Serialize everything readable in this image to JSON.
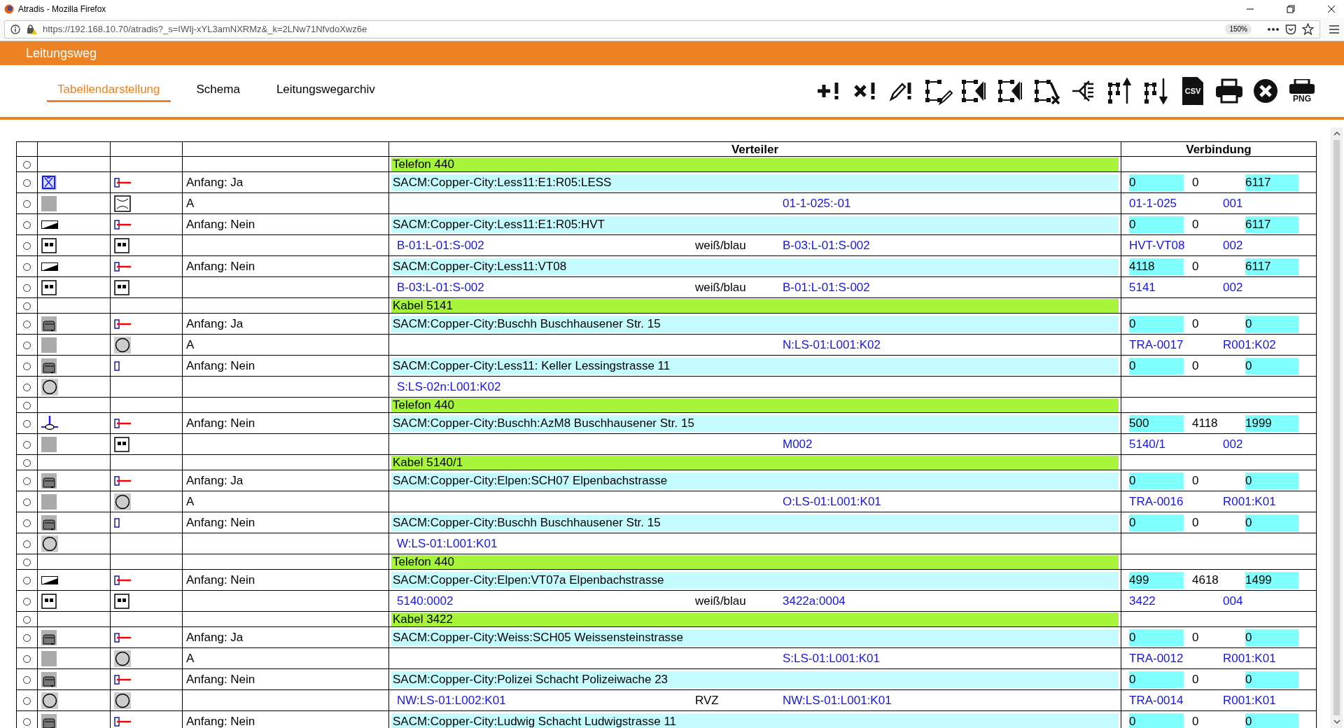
{
  "browser": {
    "title": "Atradis - Mozilla Firefox",
    "url": "https://192.168.10.70/atradis?_s=IWIj-xYL3amNXRMz&_k=2LNw71NfvdoXwz6e",
    "zoom": "150%"
  },
  "header": {
    "title": "Leitungsweg"
  },
  "tabs": [
    {
      "label": "Tabellendarstellung",
      "selected": true
    },
    {
      "label": "Schema",
      "selected": false
    },
    {
      "label": "Leitungswegarchiv",
      "selected": false
    }
  ],
  "toolbar": [
    {
      "kind": "add"
    },
    {
      "kind": "delete"
    },
    {
      "kind": "edit"
    },
    {
      "kind": "edit-route"
    },
    {
      "kind": "route-left"
    },
    {
      "kind": "route-split"
    },
    {
      "kind": "route-remove"
    },
    {
      "kind": "fan"
    },
    {
      "kind": "up"
    },
    {
      "kind": "down"
    },
    {
      "kind": "csv",
      "label": "CSV"
    },
    {
      "kind": "print"
    },
    {
      "kind": "close"
    },
    {
      "kind": "png",
      "label": "PNG"
    }
  ],
  "table": {
    "headers": {
      "verteiler": "Verteiler",
      "verbindung": "Verbindung"
    },
    "rows": [
      {
        "kind": "group",
        "selected": false,
        "label": "Telefon 440"
      },
      {
        "kind": "main",
        "selected": false,
        "icon_1": {
          "kind": "splice"
        },
        "icon_2": {
          "kind": "plug"
        },
        "text": "Anfang: Ja",
        "verteiler": "SACM:Copper-City:Less11:E1:R05:LESS",
        "verbindung": [
          "0",
          "0",
          "6117"
        ]
      },
      {
        "kind": "detail",
        "selected": false,
        "icon_1": {
          "kind": "blank"
        },
        "icon_2": {
          "kind": "cross-box"
        },
        "text": "A",
        "verteiler_right": "01-1-025:-01",
        "verbindung": [
          "01-1-025",
          "001"
        ]
      },
      {
        "kind": "main",
        "selected": false,
        "icon_1": {
          "kind": "ramp"
        },
        "icon_2": {
          "kind": "plug"
        },
        "text": "Anfang: Nein",
        "verteiler": "SACM:Copper-City:Less11:E1:R05:HVT",
        "verbindung": [
          "0",
          "0",
          "6117"
        ]
      },
      {
        "kind": "detail",
        "selected": false,
        "icon_1": {
          "kind": "socket"
        },
        "icon_2": {
          "kind": "socket"
        },
        "verteiler_left": "B-01:L-01:S-002",
        "verteiler_middle": "weiß/blau",
        "verteiler_right": "B-03:L-01:S-002",
        "verbindung": [
          "HVT-VT08",
          "002"
        ]
      },
      {
        "kind": "main",
        "selected": false,
        "icon_1": {
          "kind": "ramp"
        },
        "icon_2": {
          "kind": "plug"
        },
        "text": "Anfang: Nein",
        "verteiler": "SACM:Copper-City:Less11:VT08",
        "verbindung": [
          "4118",
          "0",
          "6117"
        ]
      },
      {
        "kind": "detail",
        "selected": false,
        "icon_1": {
          "kind": "socket"
        },
        "icon_2": {
          "kind": "socket"
        },
        "verteiler_left": "B-03:L-01:S-002",
        "verteiler_middle": "weiß/blau",
        "verteiler_right": "B-01:L-01:S-002",
        "verbindung": [
          "5141",
          "002"
        ]
      },
      {
        "kind": "group",
        "selected": false,
        "label": "Kabel 5141"
      },
      {
        "kind": "main",
        "selected": false,
        "icon_1": {
          "kind": "shaft"
        },
        "icon_2": {
          "kind": "plug"
        },
        "text": "Anfang: Ja",
        "verteiler": "SACM:Copper-City:Buschh Buschhausener Str. 15",
        "verbindung": [
          "0",
          "0",
          "0"
        ]
      },
      {
        "kind": "detail",
        "selected": false,
        "icon_1": {
          "kind": "blank"
        },
        "icon_2": {
          "kind": "circle"
        },
        "text": "A",
        "verteiler_right": "N:LS-01:L001:K02",
        "verbindung": [
          "TRA-0017",
          "R001:K02"
        ]
      },
      {
        "kind": "main",
        "selected": false,
        "icon_1": {
          "kind": "shaft"
        },
        "icon_2": {
          "kind": "marker"
        },
        "text": "Anfang: Nein",
        "verteiler": "SACM:Copper-City:Less11: Keller Lessingstrasse 11",
        "verbindung": [
          "0",
          "0",
          "0"
        ]
      },
      {
        "kind": "detail",
        "selected": false,
        "icon_1": {
          "kind": "circle"
        },
        "verteiler_left": "S:LS-02n:L001:K02"
      },
      {
        "kind": "group",
        "selected": false,
        "label": "Telefon 440"
      },
      {
        "kind": "main",
        "selected": false,
        "icon_1": {
          "kind": "pole"
        },
        "icon_2": {
          "kind": "plug"
        },
        "text": "Anfang: Nein",
        "verteiler": "SACM:Copper-City:Buschh:AzM8 Buschhausener Str. 15",
        "verbindung": [
          "500",
          "4118",
          "1999"
        ]
      },
      {
        "kind": "detail",
        "selected": false,
        "icon_1": {
          "kind": "blank"
        },
        "icon_2": {
          "kind": "socket"
        },
        "verteiler_right": "M002",
        "verbindung": [
          "5140/1",
          "002"
        ]
      },
      {
        "kind": "group",
        "selected": false,
        "label": "Kabel 5140/1"
      },
      {
        "kind": "main",
        "selected": false,
        "icon_1": {
          "kind": "shaft"
        },
        "icon_2": {
          "kind": "plug"
        },
        "text": "Anfang: Ja",
        "verteiler": "SACM:Copper-City:Elpen:SCH07 Elpenbachstrasse",
        "verbindung": [
          "0",
          "0",
          "0"
        ]
      },
      {
        "kind": "detail",
        "selected": false,
        "icon_1": {
          "kind": "blank"
        },
        "icon_2": {
          "kind": "circle"
        },
        "text": "A",
        "verteiler_right": "O:LS-01:L001:K01",
        "verbindung": [
          "TRA-0016",
          "R001:K01"
        ]
      },
      {
        "kind": "main",
        "selected": false,
        "icon_1": {
          "kind": "shaft"
        },
        "icon_2": {
          "kind": "marker"
        },
        "text": "Anfang: Nein",
        "verteiler": "SACM:Copper-City:Buschh Buschhausener Str. 15",
        "verbindung": [
          "0",
          "0",
          "0"
        ]
      },
      {
        "kind": "detail",
        "selected": false,
        "icon_1": {
          "kind": "circle"
        },
        "verteiler_left": "W:LS-01:L001:K01"
      },
      {
        "kind": "group",
        "selected": false,
        "label": "Telefon 440"
      },
      {
        "kind": "main",
        "selected": false,
        "icon_1": {
          "kind": "ramp"
        },
        "icon_2": {
          "kind": "plug"
        },
        "text": "Anfang: Nein",
        "verteiler": "SACM:Copper-City:Elpen:VT07a Elpenbachstrasse",
        "verbindung": [
          "499",
          "4618",
          "1499"
        ]
      },
      {
        "kind": "detail",
        "selected": false,
        "icon_1": {
          "kind": "socket"
        },
        "icon_2": {
          "kind": "socket"
        },
        "verteiler_left": "5140:0002",
        "verteiler_middle": "weiß/blau",
        "verteiler_right": "3422a:0004",
        "verbindung": [
          "3422",
          "004"
        ]
      },
      {
        "kind": "group",
        "selected": false,
        "label": "Kabel 3422"
      },
      {
        "kind": "main",
        "selected": false,
        "icon_1": {
          "kind": "shaft"
        },
        "icon_2": {
          "kind": "plug"
        },
        "text": "Anfang: Ja",
        "verteiler": "SACM:Copper-City:Weiss:SCH05 Weissensteinstrasse",
        "verbindung": [
          "0",
          "0",
          "0"
        ]
      },
      {
        "kind": "detail",
        "selected": false,
        "icon_1": {
          "kind": "blank"
        },
        "icon_2": {
          "kind": "circle"
        },
        "text": "A",
        "verteiler_right": "S:LS-01:L001:K01",
        "verbindung": [
          "TRA-0012",
          "R001:K01"
        ]
      },
      {
        "kind": "main",
        "selected": false,
        "icon_1": {
          "kind": "shaft"
        },
        "icon_2": {
          "kind": "plug"
        },
        "text": "Anfang: Nein",
        "verteiler": "SACM:Copper-City:Polizei Schacht Polizeiwache 23",
        "verbindung": [
          "0",
          "0",
          "0"
        ]
      },
      {
        "kind": "detail",
        "selected": false,
        "icon_1": {
          "kind": "circle"
        },
        "icon_2": {
          "kind": "circle"
        },
        "verteiler_left": "NW:LS-01:L002:K01",
        "verteiler_middle": "RVZ",
        "verteiler_right": "NW:LS-01:L001:K01",
        "verbindung": [
          "TRA-0014",
          "R001:K01"
        ]
      },
      {
        "kind": "main",
        "selected": false,
        "icon_1": {
          "kind": "shaft"
        },
        "icon_2": {
          "kind": "plug"
        },
        "text": "Anfang: Nein",
        "verteiler": "SACM:Copper-City:Ludwig Schacht Ludwigstrasse 11",
        "verbindung": [
          "0",
          "0",
          "0"
        ]
      }
    ]
  }
}
